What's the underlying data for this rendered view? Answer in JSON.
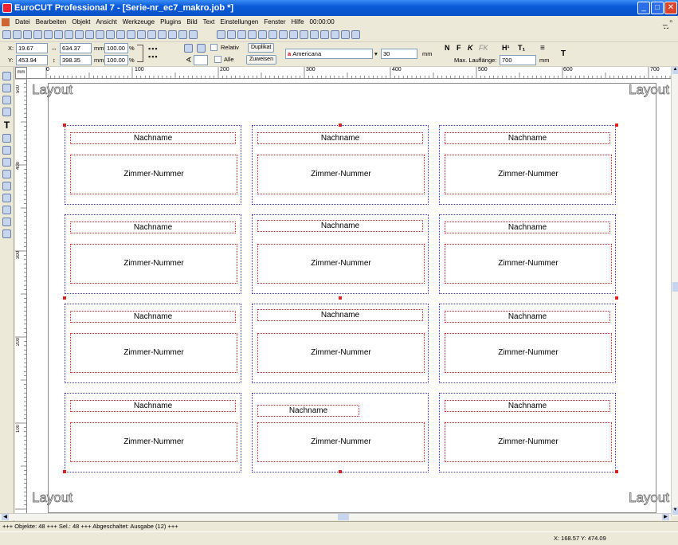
{
  "window": {
    "title": "EuroCUT Professional 7 - [Serie-nr_ec7_makro.job *]"
  },
  "menu": [
    "Datei",
    "Bearbeiten",
    "Objekt",
    "Ansicht",
    "Werkzeuge",
    "Plugins",
    "Bild",
    "Text",
    "Einstellungen",
    "Fenster",
    "Hilfe",
    "00:00:00"
  ],
  "props": {
    "x_label": "X:",
    "x_value": "19.67",
    "y_label": "Y:",
    "y_value": "453.94",
    "width_value": "634.37",
    "height_value": "398.35",
    "unit_mm": "mm",
    "scale_x": "100.00",
    "scale_y": "100.00",
    "percent": "%",
    "relativ_label": "Relativ",
    "alle_label": "Alle",
    "duplikat_label": "Duplikat",
    "zuweisen_label": "Zuweisen"
  },
  "font": {
    "name": "Americana",
    "size": "30",
    "unit": "mm",
    "bold_label": "N",
    "fett_label": "F",
    "italic_label": "K",
    "fk_label": "FK",
    "sup_label": "H¹",
    "sub_label": "T₁",
    "maxlen_label": "Max. Lauflänge:",
    "maxlen_value": "700",
    "maxlen_unit": "mm",
    "t_label": "T"
  },
  "ruler": {
    "unit": "mm",
    "h_ticks": [
      "0",
      "100",
      "200",
      "300",
      "400",
      "500",
      "600",
      "700"
    ],
    "v_ticks": [
      "500",
      "400",
      "300",
      "200",
      "100"
    ]
  },
  "canvas": {
    "layout_label": "Layout"
  },
  "labels": {
    "name_field": "Nachname",
    "room_field": "Zimmer-Nummer"
  },
  "status": {
    "text": "+++ Objekte: 48 +++ Sel.: 48 +++ Abgeschaltet:  Ausgabe (12) +++",
    "coords": "X: 168.57 Y: 474.09"
  },
  "colors": {
    "title_bar": "#0a5ad8",
    "selection_handle": "#e02020",
    "card_border": "#3a3ad8"
  }
}
